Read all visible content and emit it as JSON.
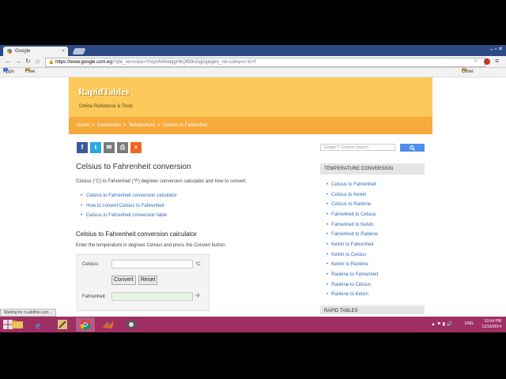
{
  "browser": {
    "tab_title": "Google",
    "tab_close": "×",
    "window_controls": "–  ▫  ✕",
    "url_host": "https://www.google.com.eg",
    "url_path": "/?gfe_rd=cr&ei=YAlpVMWelqgH8QfB9oDgDg&gws_rd=ssl#q=c+to+f",
    "back_icon": "←",
    "forward_icon": "→",
    "reload_icon": "↻",
    "home_icon": "⌂",
    "lock_icon": "🔒",
    "star_icon": "☆",
    "menu_icon": "≡",
    "bookmarks": {
      "apps": "Apps",
      "free_lisps": "Free Lisps",
      "other": "Other bookmarks"
    },
    "status_text": "Waiting for rt.addthis.com..."
  },
  "site": {
    "logo": "RapidTables",
    "tagline": "Online Reference & Tools",
    "breadcrumb": [
      "Home",
      "Conversion",
      "Temperature",
      "Celsius to Fahrenheit"
    ],
    "breadcrumb_sep": ">",
    "social": [
      {
        "name": "facebook",
        "glyph": "f",
        "color": "#3b5998"
      },
      {
        "name": "twitter",
        "glyph": "t",
        "color": "#2aa9e0"
      },
      {
        "name": "email",
        "glyph": "✉",
        "color": "#7a7a7a"
      },
      {
        "name": "print",
        "glyph": "⎙",
        "color": "#7a7a7a"
      },
      {
        "name": "share",
        "glyph": "+",
        "color": "#f26522"
      }
    ],
    "title": "Celsius to Fahrenheit conversion",
    "intro": "Celsius (°C) to Fahrenheit (°F) degrees conversion calculator and how to convert.",
    "toc": [
      "Celsius to Fahrenheit conversion calculator",
      "How to convert Celsius to Fahrenheit",
      "Celsius to Fahrenheit conversion table"
    ],
    "calc_title": "Celsius to Fahrenheit conversion calculator",
    "calc_instructions": "Enter the temperature in degrees Celsius and press the Convert button:",
    "calc": {
      "celsius_label": "Celsius:",
      "celsius_unit": "°C",
      "convert_label": "Convert",
      "reset_label": "Reset",
      "fahrenheit_label": "Fahrenheit:",
      "fahrenheit_unit": "°F",
      "celsius_value": "",
      "fahrenheit_value": ""
    },
    "search_placeholder": "Google™ Custom Search",
    "sidebar_title": "TEMPERATURE CONVERSION",
    "sidebar_links": [
      "Celsius to Fahrenheit",
      "Celsius to Kelvin",
      "Celsius to Rankine",
      "Fahrenheit to Celsius",
      "Fahrenheit to Kelvin",
      "Fahrenheit to Rankine",
      "Kelvin to Fahrenheit",
      "Kelvin to Celsius",
      "Kelvin to Rankine",
      "Rankine to Fahrenheit",
      "Rankine to Celsius",
      "Rankine to Kelvin"
    ],
    "sidebar_title2": "RAPID TABLES"
  },
  "taskbar": {
    "language": "ENG",
    "time": "10:04 PM",
    "date": "11/16/2014",
    "tray_icons": "▲ ⚑ ▮ 🔊"
  },
  "colors": {
    "header": "#fcc95a",
    "breadcrumb": "#f6ab3c",
    "link": "#2d6ab5",
    "taskbar": "#9f2e63"
  }
}
